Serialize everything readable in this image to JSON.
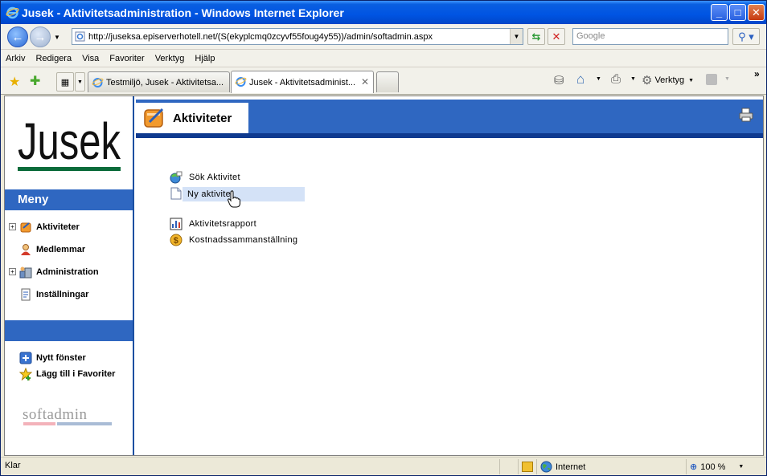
{
  "window": {
    "title": "Jusek - Aktivitetsadministration - Windows Internet Explorer",
    "controls": {
      "minimize": "_",
      "maximize": "□",
      "close": "✕"
    }
  },
  "address": {
    "url": "http://juseksa.episerverhotell.net/(S(ekyplcmq0zcyvf55foug4y55))/admin/softadmin.aspx",
    "search_placeholder": "Google"
  },
  "menu": [
    "Arkiv",
    "Redigera",
    "Visa",
    "Favoriter",
    "Verktyg",
    "Hjälp"
  ],
  "tabs": [
    {
      "label": "Testmiljö, Jusek - Aktivitetsa...",
      "active": false
    },
    {
      "label": "Jusek - Aktivitetsadminist...",
      "active": true
    }
  ],
  "toolbar": {
    "tools_label": "Verktyg"
  },
  "sidebar": {
    "logo_text": "Jusek",
    "menu_title": "Meny",
    "items": [
      {
        "label": "Aktiviteter",
        "expandable": true,
        "icon": "activities-icon"
      },
      {
        "label": "Medlemmar",
        "expandable": false,
        "icon": "members-icon"
      },
      {
        "label": "Administration",
        "expandable": true,
        "icon": "administration-icon"
      },
      {
        "label": "Inställningar",
        "expandable": false,
        "icon": "settings-icon"
      }
    ],
    "actions": [
      {
        "label": "Nytt fönster",
        "icon": "new-window-icon"
      },
      {
        "label": "Lägg till i Favoriter",
        "icon": "add-favorite-icon"
      }
    ],
    "footer_brand": "softadmin"
  },
  "main": {
    "heading": "Aktiviteter",
    "links": [
      {
        "label": "Sök Aktivitet",
        "icon": "search-activity-icon"
      },
      {
        "label": "Ny aktivitet",
        "icon": "new-document-icon",
        "hovered": true
      },
      {
        "label": "Aktivitetsrapport",
        "icon": "report-chart-icon"
      },
      {
        "label": "Kostnadssammanställning",
        "icon": "cost-coin-icon"
      }
    ]
  },
  "status": {
    "text": "Klar",
    "zone": "Internet",
    "zoom": "100 %"
  },
  "colors": {
    "brand_blue": "#2f67c1",
    "dark_blue": "#0f3a8f",
    "logo_green": "#0a6b3a",
    "hover": "#d4e2f7"
  }
}
